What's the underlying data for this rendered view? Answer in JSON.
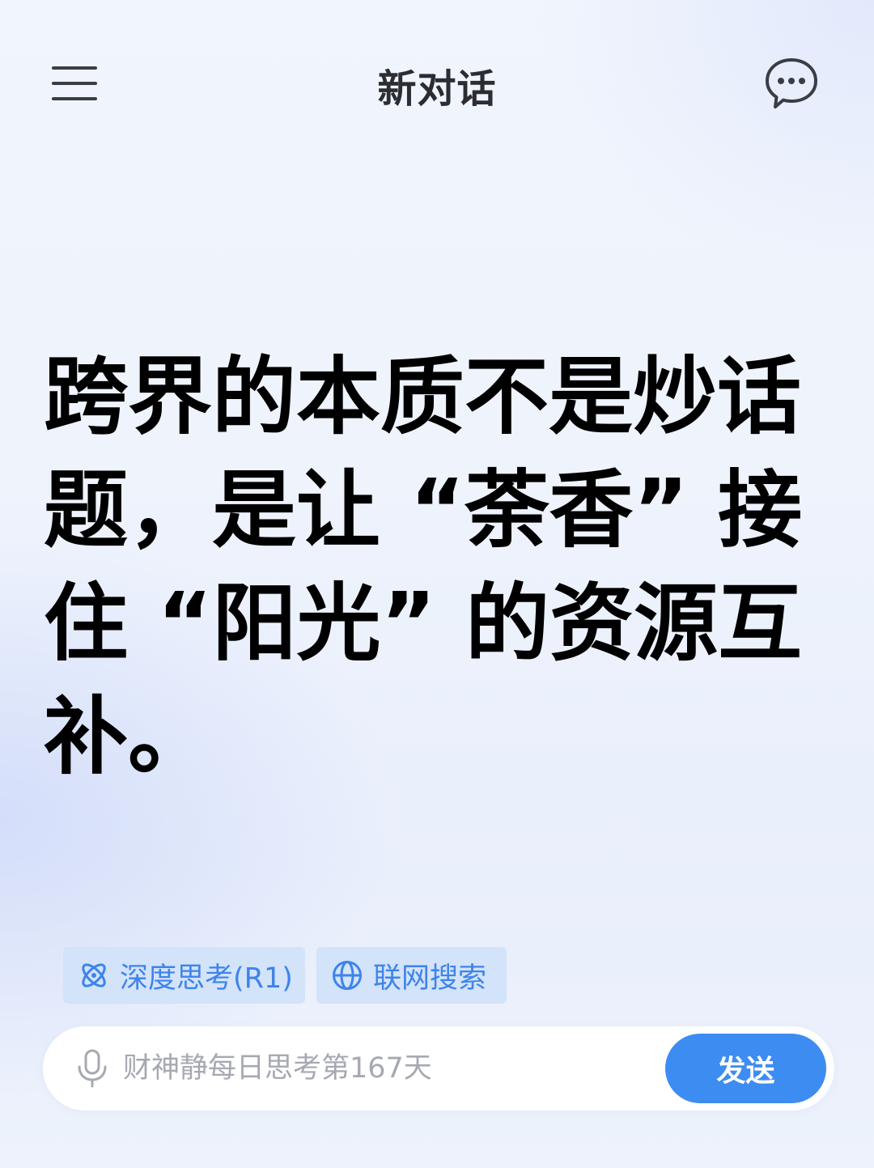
{
  "header": {
    "title": "新对话",
    "menu_icon": "hamburger-menu-icon",
    "chat_icon": "chat-bubble-icon"
  },
  "main": {
    "quote": "跨界的本质不是炒话题，是让 “荼香” 接住 “阳光” 的资源互补。"
  },
  "chips": {
    "deep_think": {
      "label": "深度思考(R1)",
      "icon": "atom-icon"
    },
    "web_search": {
      "label": "联网搜索",
      "icon": "globe-icon"
    }
  },
  "input": {
    "placeholder": "财神静每日思考第167天",
    "value": "",
    "mic_icon": "microphone-icon"
  },
  "send_button": {
    "label": "发送"
  },
  "colors": {
    "accent": "#3d8cf2",
    "chip_bg": "#d2e3fa",
    "chip_text": "#3f83ea",
    "title_text": "#2b2d33",
    "quote_text": "#000000"
  }
}
